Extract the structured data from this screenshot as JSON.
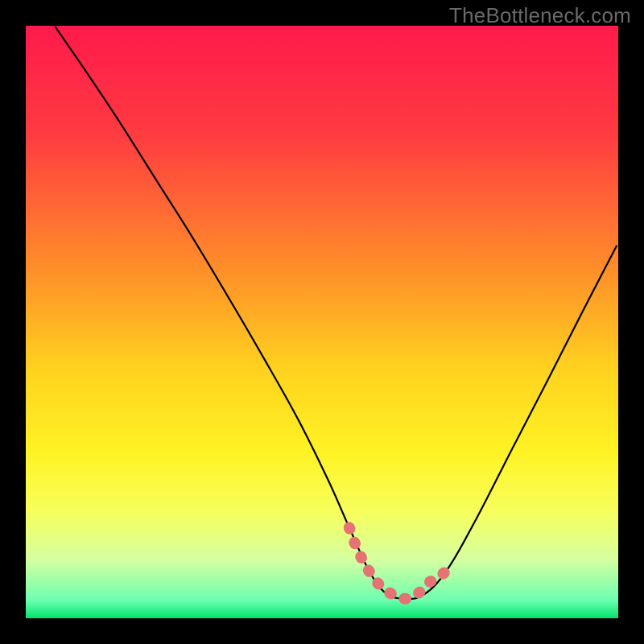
{
  "watermark": "TheBottleneck.com",
  "chart_data": {
    "type": "line",
    "title": "",
    "xlabel": "",
    "ylabel": "",
    "xlim": [
      0,
      100
    ],
    "ylim": [
      0,
      100
    ],
    "gradient": {
      "stops": [
        {
          "offset": 0.0,
          "color": "#ff1a4b"
        },
        {
          "offset": 0.18,
          "color": "#ff3a41"
        },
        {
          "offset": 0.4,
          "color": "#ff8a2a"
        },
        {
          "offset": 0.58,
          "color": "#ffd21f"
        },
        {
          "offset": 0.72,
          "color": "#fff324"
        },
        {
          "offset": 0.82,
          "color": "#f7ff5c"
        },
        {
          "offset": 0.9,
          "color": "#d6ffa0"
        },
        {
          "offset": 0.97,
          "color": "#6cffb0"
        },
        {
          "offset": 1.0,
          "color": "#00e46a"
        }
      ]
    },
    "series": [
      {
        "name": "bottleneck-curve",
        "stroke": "#000000",
        "x": [
          5.0,
          10.5,
          16.0,
          22.0,
          28.0,
          34.0,
          40.0,
          46.0,
          51.0,
          54.6,
          58.0,
          60.8,
          64.0,
          67.2,
          71.0,
          76.0,
          82.0,
          88.0,
          94.0,
          99.7
        ],
        "y": [
          99.8,
          91.8,
          83.5,
          74.0,
          64.5,
          54.5,
          44.2,
          33.5,
          23.4,
          15.3,
          7.9,
          4.2,
          3.3,
          4.0,
          8.0,
          16.7,
          28.4,
          40.0,
          51.8,
          62.8
        ]
      },
      {
        "name": "optimal-range-marker",
        "stroke": "#e57373",
        "x": [
          54.6,
          55.8,
          57.2,
          58.6,
          60.0,
          61.4,
          62.8,
          64.0,
          65.2,
          66.6,
          68.0,
          69.4,
          71.0
        ],
        "y": [
          15.3,
          12.0,
          9.2,
          7.0,
          5.3,
          4.3,
          3.7,
          3.3,
          3.6,
          4.5,
          6.0,
          6.7,
          8.0
        ]
      }
    ]
  }
}
